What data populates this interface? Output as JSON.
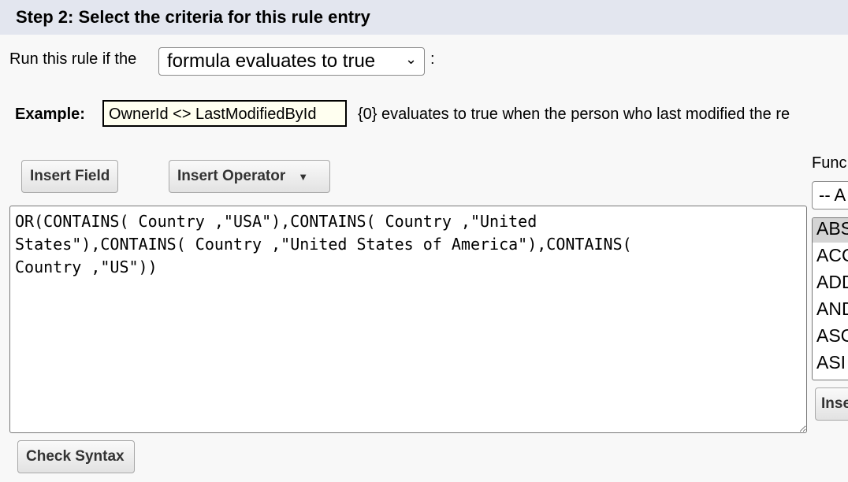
{
  "header": {
    "title": "Step 2: Select the criteria for this rule entry"
  },
  "criteria": {
    "label": "Run this rule if the",
    "selected": "formula evaluates to true",
    "suffix": ":"
  },
  "example": {
    "label": "Example:",
    "formula": "OwnerId <> LastModifiedById",
    "description": "{0} evaluates to true when the person who last modified the re"
  },
  "buttons": {
    "insert_field": "Insert Field",
    "insert_operator": "Insert Operator",
    "check_syntax": "Check Syntax",
    "insert_function": "Inse"
  },
  "formula_text": "OR(CONTAINS( Country ,\"USA\"),CONTAINS( Country ,\"United\nStates\"),CONTAINS( Country ,\"United States of America\"),CONTAINS(\nCountry ,\"US\"))",
  "functions": {
    "label": "Func",
    "category": "-- A",
    "items": [
      "ABS",
      "ACO",
      "ADD",
      "AND",
      "ASC",
      "ASI"
    ]
  }
}
